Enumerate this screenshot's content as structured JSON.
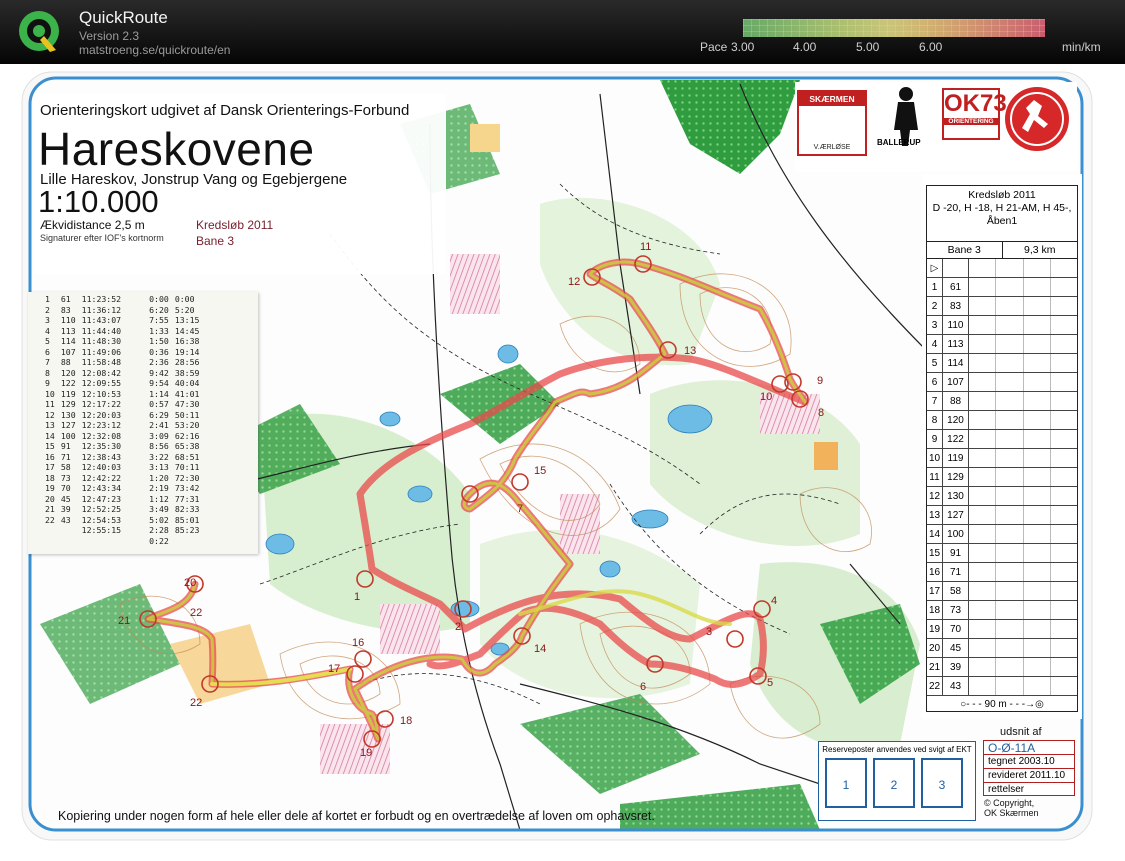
{
  "app": {
    "title": "QuickRoute",
    "version": "Version 2.3",
    "url": "matstroeng.se/quickroute/en"
  },
  "pace_legend": {
    "label": "Pace",
    "ticks": [
      "3.00",
      "4.00",
      "5.00",
      "6.00"
    ],
    "unit": "min/km"
  },
  "map": {
    "subtitle_line1": "Orienteringskort udgivet af Dansk Orienterings-Forbund",
    "title": "Hareskovene",
    "subtitle_line2": "Lille Hareskov, Jonstrup Vang og Egebjergene",
    "scale": "1:10.000",
    "contour": "Ækvidistance 2,5 m",
    "signatures": "Signaturer efter IOF's kortnorm",
    "event_name": "Kredsløb 2011",
    "event_course": "Bane 3",
    "copy_notice": "Kopiering under nogen form af hele eller dele af kortet er forbudt og en overtrædelse af loven om ophavsret.",
    "reserve_label": "Reserveposter anvendes ved svigt af EKT",
    "reserve_cells": [
      "1",
      "2",
      "3"
    ],
    "udsnit": {
      "title": "udsnit af",
      "id": "O-Ø-11A",
      "drawn": "tegnet 2003.10",
      "revised": "revideret 2011.10",
      "corrections": "rettelser"
    },
    "copyright": "© Copyright,",
    "copyright_holder": "OK Skærmen"
  },
  "logos": {
    "skaermen_top": "SKÆRMEN",
    "skaermen_bottom": "V.ÆRLØSE",
    "ballerup": "BALLERUP",
    "ok73_big": "OK73",
    "ok73_small": "ORIENTERING"
  },
  "control_description": {
    "event": "Kredsløb 2011",
    "classes_line1": "D -20, H -18, H 21-AM, H 45-,",
    "classes_line2": "Åben1",
    "course": "Bane 3",
    "length": "9,3 km",
    "controls": [
      {
        "num": "1",
        "code": "61"
      },
      {
        "num": "2",
        "code": "83"
      },
      {
        "num": "3",
        "code": "110"
      },
      {
        "num": "4",
        "code": "113"
      },
      {
        "num": "5",
        "code": "114"
      },
      {
        "num": "6",
        "code": "107"
      },
      {
        "num": "7",
        "code": "88"
      },
      {
        "num": "8",
        "code": "120"
      },
      {
        "num": "9",
        "code": "122"
      },
      {
        "num": "10",
        "code": "119"
      },
      {
        "num": "11",
        "code": "129"
      },
      {
        "num": "12",
        "code": "130"
      },
      {
        "num": "13",
        "code": "127"
      },
      {
        "num": "14",
        "code": "100"
      },
      {
        "num": "15",
        "code": "91"
      },
      {
        "num": "16",
        "code": "71"
      },
      {
        "num": "17",
        "code": "58"
      },
      {
        "num": "18",
        "code": "73"
      },
      {
        "num": "19",
        "code": "70"
      },
      {
        "num": "20",
        "code": "45"
      },
      {
        "num": "21",
        "code": "39"
      },
      {
        "num": "22",
        "code": "43"
      }
    ],
    "finish": "90 m"
  },
  "splits": [
    [
      "1",
      "61",
      "11:23:52",
      "0:00",
      "0:00"
    ],
    [
      "2",
      "83",
      "11:36:12",
      "6:20",
      "5:20"
    ],
    [
      "3",
      "110",
      "11:43:07",
      "7:55",
      "13:15"
    ],
    [
      "4",
      "113",
      "11:44:40",
      "1:33",
      "14:45"
    ],
    [
      "5",
      "114",
      "11:48:30",
      "1:50",
      "16:38"
    ],
    [
      "6",
      "107",
      "11:49:06",
      "0:36",
      "19:14"
    ],
    [
      "7",
      "88",
      "11:58:48",
      "2:36",
      "28:56"
    ],
    [
      "8",
      "120",
      "12:08:42",
      "9:42",
      "38:59"
    ],
    [
      "9",
      "122",
      "12:09:55",
      "9:54",
      "40:04"
    ],
    [
      "10",
      "119",
      "12:10:53",
      "1:14",
      "41:01"
    ],
    [
      "11",
      "129",
      "12:17:22",
      "0:57",
      "47:30"
    ],
    [
      "12",
      "130",
      "12:20:03",
      "6:29",
      "50:11"
    ],
    [
      "13",
      "127",
      "12:23:12",
      "2:41",
      "53:20"
    ],
    [
      "14",
      "100",
      "12:32:08",
      "3:09",
      "62:16"
    ],
    [
      "15",
      "91",
      "12:35:30",
      "8:56",
      "65:38"
    ],
    [
      "16",
      "71",
      "12:38:43",
      "3:22",
      "68:51"
    ],
    [
      "17",
      "58",
      "12:40:03",
      "3:13",
      "70:11"
    ],
    [
      "18",
      "73",
      "12:42:22",
      "1:20",
      "72:30"
    ],
    [
      "19",
      "70",
      "12:43:34",
      "2:19",
      "73:42"
    ],
    [
      "20",
      "45",
      "12:47:23",
      "1:12",
      "77:31"
    ],
    [
      "21",
      "39",
      "12:52:25",
      "3:49",
      "82:33"
    ],
    [
      "22",
      "43",
      "12:54:53",
      "5:02",
      "85:01"
    ],
    [
      "",
      "",
      "12:55:15",
      "2:28",
      "85:23"
    ],
    [
      "",
      "",
      "",
      "0:22",
      ""
    ]
  ],
  "colors": {
    "route_fast": "#9acd32",
    "route_slow": "#e84b4b",
    "forest": "#ffffff",
    "open_land": "#f5c98a",
    "water": "#7fc5e8",
    "green": "#3aa845",
    "blue_frame": "#3a8fd0",
    "control": "#c0392b"
  }
}
